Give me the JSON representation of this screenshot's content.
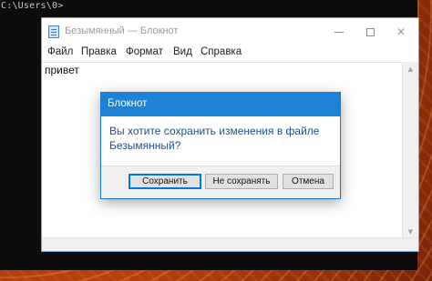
{
  "console": {
    "prompt_text": "C:\\Users\\0>"
  },
  "notepad": {
    "title": "Безымянный — Блокнот",
    "menu": [
      "Файл",
      "Правка",
      "Формат",
      "Вид",
      "Справка"
    ],
    "content": "привет",
    "window_buttons": {
      "minimize_icon": "minimize-icon",
      "maximize_icon": "maximize-icon",
      "close_icon": "close-icon",
      "close_glyph": "✕"
    }
  },
  "dialog": {
    "title": "Блокнот",
    "message_line1": "Вы хотите сохранить изменения в файле",
    "message_line2": "Безымянный?",
    "buttons": {
      "save": "Сохранить",
      "dont_save": "Не сохранять",
      "cancel": "Отмена"
    }
  },
  "colors": {
    "dialog_title_bg": "#1b82d7",
    "message_text": "#1f4e98",
    "desktop_bg": "#c9490f"
  }
}
